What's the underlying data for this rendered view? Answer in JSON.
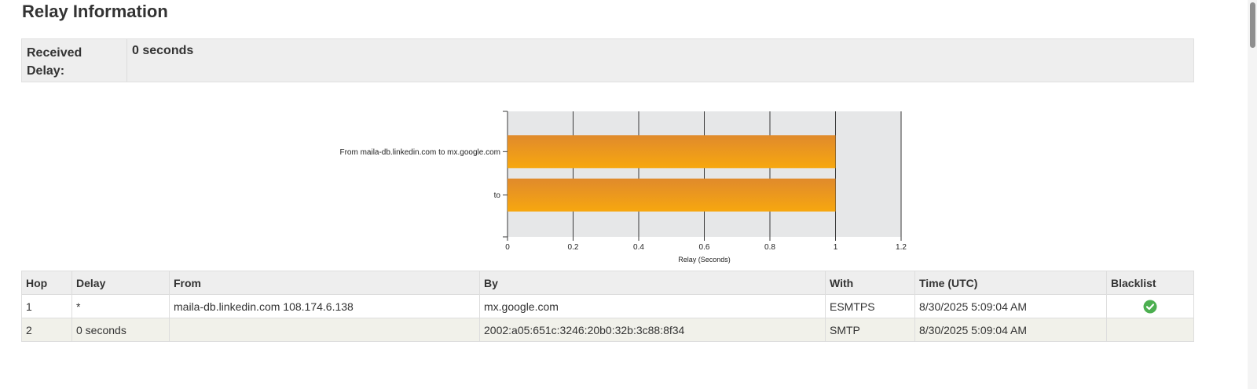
{
  "page": {
    "title": "Relay Information"
  },
  "received_delay": {
    "label": "Received Delay:",
    "value": "0 seconds"
  },
  "chart_data": {
    "type": "bar",
    "orientation": "horizontal",
    "categories": [
      "From maila-db.linkedin.com to mx.google.com",
      "to"
    ],
    "values": [
      1,
      1
    ],
    "xlabel": "Relay (Seconds)",
    "ylabel": "",
    "xlim": [
      0,
      1.2
    ],
    "xticks": [
      0,
      0.2,
      0.4,
      0.6,
      0.8,
      1,
      1.2
    ],
    "xtick_labels": [
      "0",
      "0.2",
      "0.4",
      "0.6",
      "0.8",
      "1",
      "1.2"
    ],
    "grid": "vertical",
    "colors": {
      "bar_top": "#E08A2C",
      "bar_bottom": "#F7A70F",
      "plot_bg": "#E6E7E8",
      "grid": "#3a3a3a"
    }
  },
  "table": {
    "headers": [
      "Hop",
      "Delay",
      "From",
      "By",
      "With",
      "Time (UTC)",
      "Blacklist"
    ],
    "rows": [
      {
        "hop": "1",
        "delay": "*",
        "from": "maila-db.linkedin.com 108.174.6.138",
        "by": "mx.google.com",
        "with": "ESMTPS",
        "time": "8/30/2025 5:09:04 AM",
        "blacklist_icon": "check-circle-icon",
        "blacklist_color": "#4CAF50"
      },
      {
        "hop": "2",
        "delay": "0 seconds",
        "from": "",
        "by": "2002:a05:651c:3246:20b0:32b:3c88:8f34",
        "with": "SMTP",
        "time": "8/30/2025 5:09:04 AM",
        "blacklist_icon": "",
        "blacklist_color": ""
      }
    ]
  }
}
